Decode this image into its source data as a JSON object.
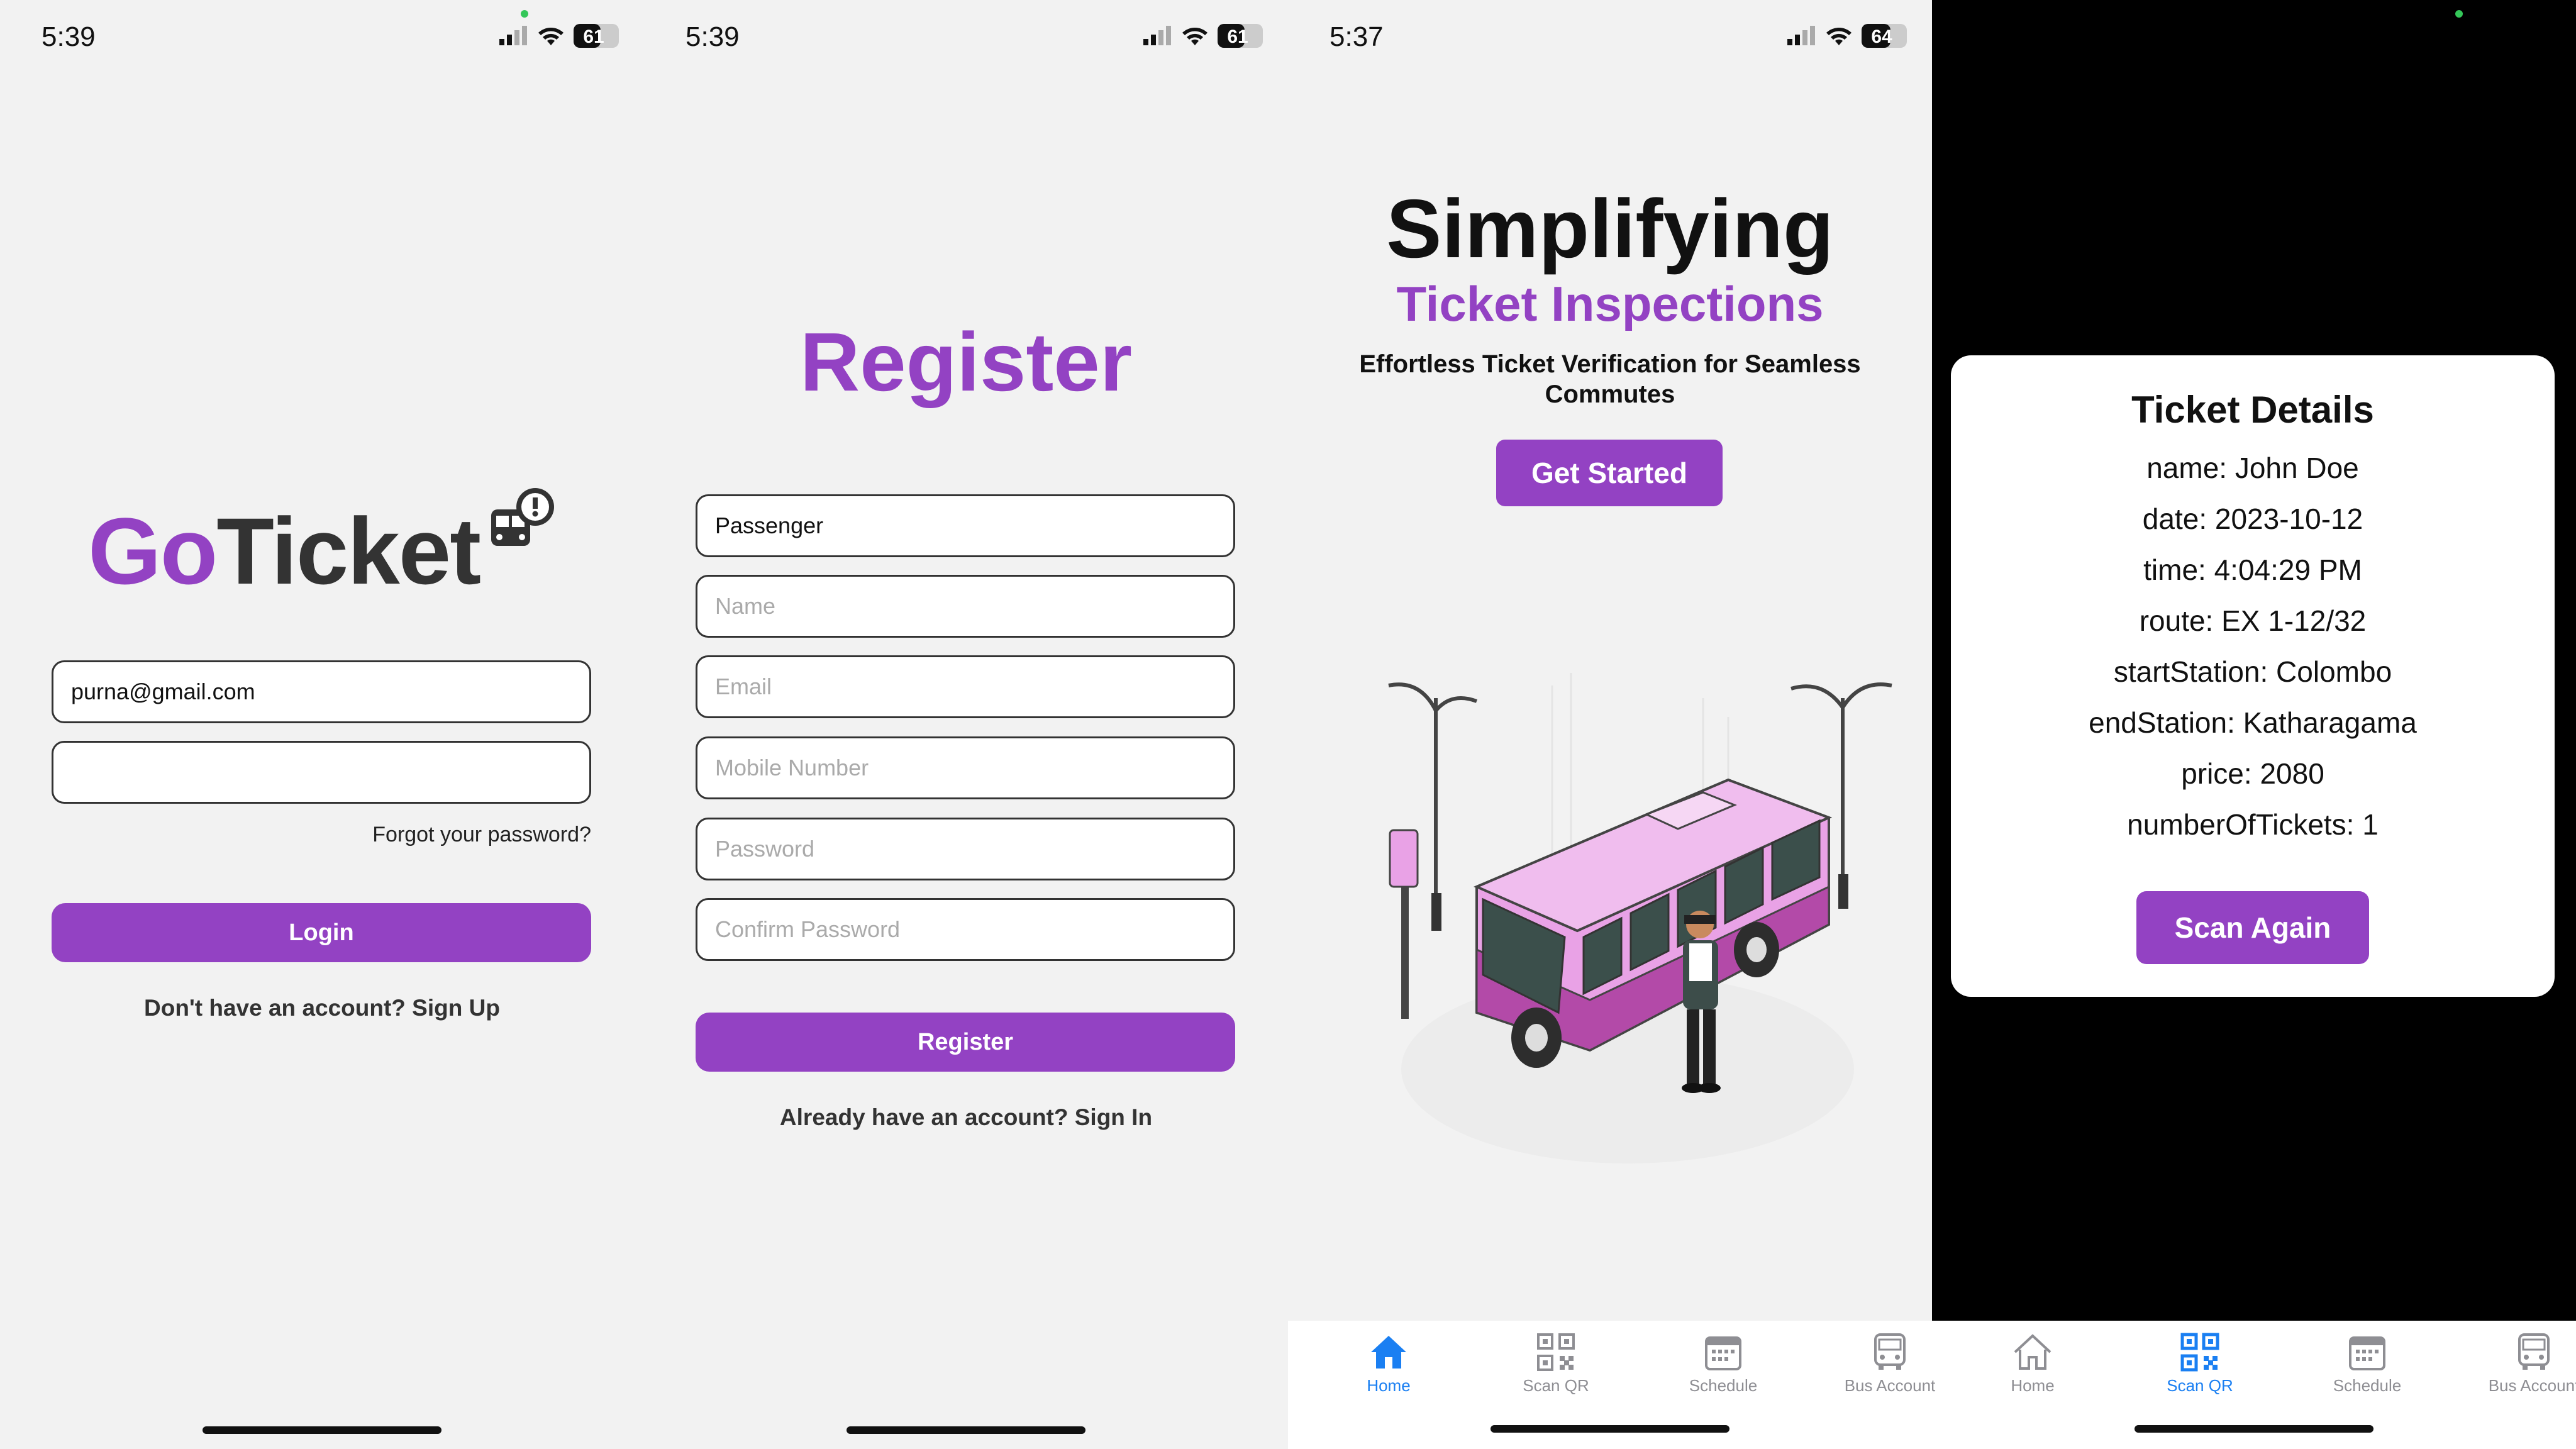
{
  "screens": {
    "login": {
      "status_time": "5:39",
      "battery": "61",
      "logo_go": "Go",
      "logo_ticket": "Ticket",
      "email_value": "purna@gmail.com",
      "password_value": "",
      "forgot_password": "Forgot your password?",
      "login_button": "Login",
      "signup_prompt": "Don't have an account? Sign Up"
    },
    "register": {
      "status_time": "5:39",
      "battery": "61",
      "title": "Register",
      "role_value": "Passenger",
      "name_placeholder": "Name",
      "email_placeholder": "Email",
      "mobile_placeholder": "Mobile Number",
      "password_placeholder": "Password",
      "confirm_placeholder": "Confirm Password",
      "register_button": "Register",
      "signin_prompt": "Already have an account? Sign In"
    },
    "home": {
      "status_time": "5:37",
      "battery": "64",
      "headline": "Simplifying",
      "subheadline": "Ticket Inspections",
      "tagline": "Effortless Ticket Verification for Seamless Commutes",
      "cta_button": "Get Started"
    },
    "scan_result": {
      "card_title": "Ticket Details",
      "rows": [
        "name: John Doe",
        "date: 2023-10-12",
        "time: 4:04:29 PM",
        "route: EX 1-12/32",
        "startStation: Colombo",
        "endStation: Katharagama",
        "price: 2080",
        "numberOfTickets: 1"
      ],
      "scan_again_button": "Scan Again"
    }
  },
  "tabbar": {
    "tabs": [
      "Home",
      "Scan QR",
      "Schedule",
      "Bus Account"
    ],
    "active_color": "#1a7ff2",
    "inactive_color": "#8e8e93"
  },
  "colors": {
    "brand_purple": "#9342c3",
    "bus_pink": "#e9a2e6"
  }
}
